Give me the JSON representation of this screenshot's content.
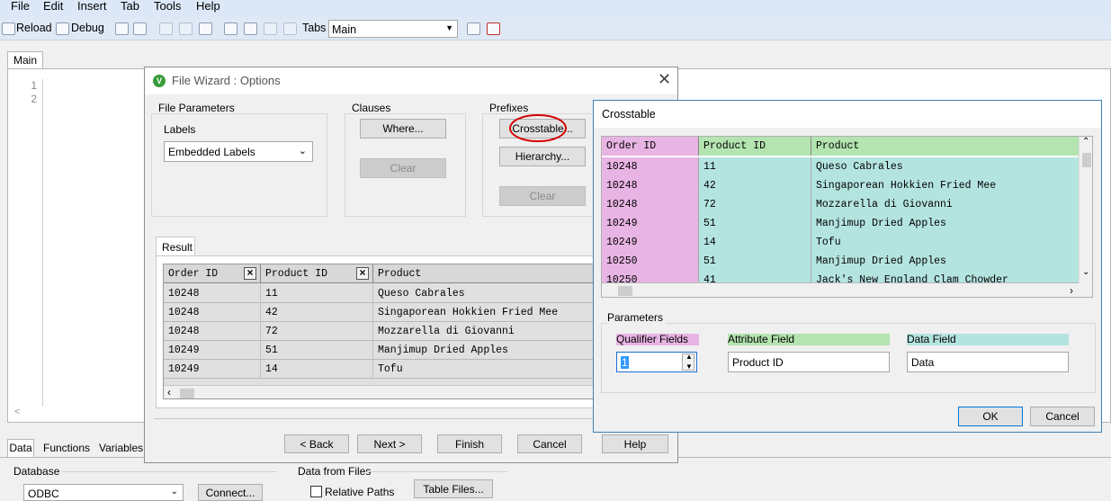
{
  "menu": [
    "File",
    "Edit",
    "Insert",
    "Tab",
    "Tools",
    "Help"
  ],
  "toolbar": {
    "reload": "Reload",
    "debug": "Debug",
    "tabs_label": "Tabs",
    "tabs_value": "Main"
  },
  "editor": {
    "tab": "Main",
    "line_numbers": [
      "1",
      "2"
    ]
  },
  "bottom_panel": {
    "tabs": [
      "Data",
      "Functions",
      "Variables"
    ],
    "database_label": "Database",
    "database_value": "ODBC",
    "connect": "Connect...",
    "data_from_files": "Data from Files",
    "relative_paths": "Relative Paths",
    "table_files": "Table Files..."
  },
  "wizard": {
    "title": "File Wizard : Options",
    "file_parameters": "File Parameters",
    "labels_label": "Labels",
    "labels_value": "Embedded Labels",
    "clauses": "Clauses",
    "where": "Where...",
    "clear1": "Clear",
    "prefixes": "Prefixes",
    "crosstable": "Crosstable...",
    "hierarchy": "Hierarchy...",
    "clear2": "Clear",
    "result_tab": "Result",
    "columns": [
      "Order ID",
      "Product ID",
      "Product"
    ],
    "rows": [
      [
        "10248",
        "11",
        "Queso Cabrales"
      ],
      [
        "10248",
        "42",
        "Singaporean Hokkien Fried Mee"
      ],
      [
        "10248",
        "72",
        "Mozzarella di Giovanni"
      ],
      [
        "10249",
        "51",
        "Manjimup Dried Apples"
      ],
      [
        "10249",
        "14",
        "Tofu"
      ]
    ],
    "back": "< Back",
    "next": "Next >",
    "finish": "Finish",
    "cancel": "Cancel",
    "help": "Help"
  },
  "crosstable": {
    "title": "Crosstable",
    "columns": [
      "Order ID",
      "Product ID",
      "Product"
    ],
    "rows": [
      [
        "10248",
        "11",
        "Queso Cabrales"
      ],
      [
        "10248",
        "42",
        "Singaporean Hokkien Fried Mee"
      ],
      [
        "10248",
        "72",
        "Mozzarella di Giovanni"
      ],
      [
        "10249",
        "51",
        "Manjimup Dried Apples"
      ],
      [
        "10249",
        "14",
        "Tofu"
      ],
      [
        "10250",
        "51",
        "Manjimup Dried Apples"
      ],
      [
        "10250",
        "41",
        "Jack's New England Clam Chowder"
      ]
    ],
    "parameters": "Parameters",
    "qualifier_fields": "Qualifier Fields",
    "qualifier_value": "1",
    "attribute_field": "Attribute Field",
    "attribute_value": "Product ID",
    "data_field": "Data Field",
    "data_value": "Data",
    "ok": "OK",
    "cancel": "Cancel"
  },
  "colors": {
    "qualifier": "#e8b4e4",
    "attribute": "#b4e4b0",
    "data": "#b4e4e0",
    "highlight_circle": "#d40000"
  }
}
